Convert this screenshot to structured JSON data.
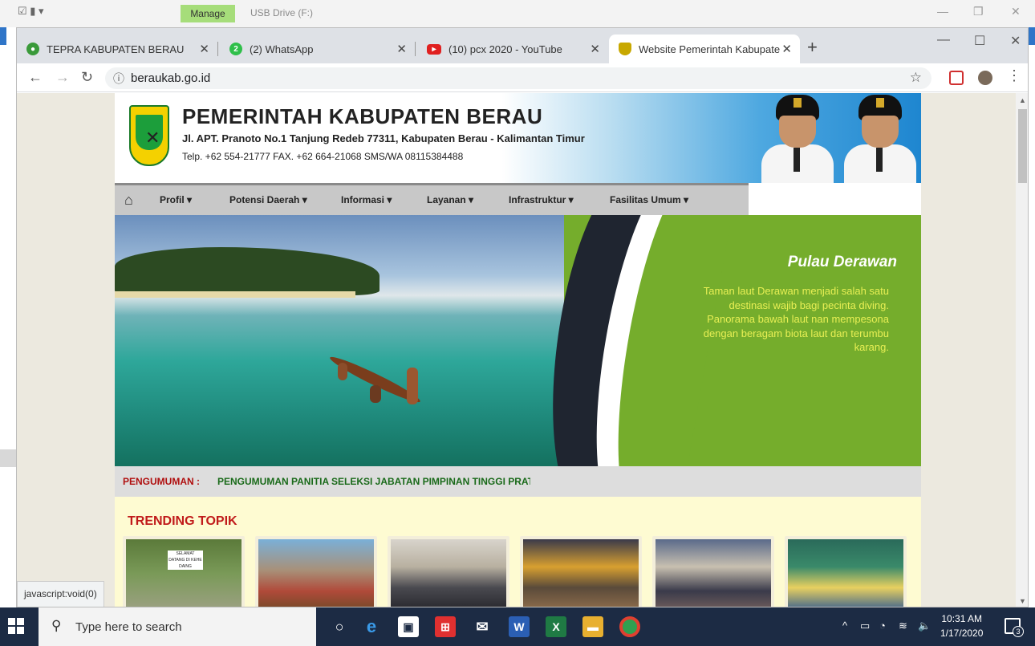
{
  "explorer": {
    "ribbon_tab": "Manage",
    "drive_title": "USB Drive (F:)"
  },
  "browser": {
    "tabs": [
      {
        "title": "TEPRA KABUPATEN BERAU",
        "icon": "tepra-favicon"
      },
      {
        "title": "(2) WhatsApp",
        "icon": "whatsapp-icon",
        "badge": "2"
      },
      {
        "title": "(10) pcx 2020 - YouTube",
        "icon": "youtube-icon"
      },
      {
        "title": "Website Pemerintah Kabupaten B",
        "icon": "berau-crest-icon",
        "active": true
      }
    ],
    "url": "beraukab.go.id",
    "status_url": "javascript:void(0)"
  },
  "site": {
    "header": {
      "title": "PEMERINTAH KABUPATEN BERAU",
      "address": "Jl. APT. Pranoto No.1 Tanjung Redeb 77311, Kabupaten Berau - Kalimantan Timur",
      "contact": "Telp. +62 554-21777  FAX. +62 664-21068  SMS/WA 08115384488"
    },
    "nav": [
      {
        "label": "Profil ▾"
      },
      {
        "label": "Potensi Daerah ▾"
      },
      {
        "label": "Informasi ▾"
      },
      {
        "label": "Layanan ▾"
      },
      {
        "label": "Infrastruktur ▾"
      },
      {
        "label": "Fasilitas Umum ▾"
      }
    ],
    "slider": {
      "title": "Pulau Derawan",
      "description": "Taman laut Derawan menjadi salah satu destinasi wajib bagi pecinta diving. Panorama bawah laut nan mempesona dengan beragam biota laut dan terumbu karang."
    },
    "announcement": {
      "label": "PENGUMUMAN :",
      "text": "PENGUMUMAN PANITIA SELEKSI JABATAN PIMPINAN TINGGI PRATAMA"
    },
    "trending": {
      "title": "TRENDING TOPIK",
      "sign_text": "SELAMAT DATANG DI KEHE DAING"
    }
  },
  "taskbar": {
    "search_placeholder": "Type here to search",
    "time": "10:31 AM",
    "date": "1/17/2020",
    "notification_count": "3"
  },
  "colors": {
    "nav_bg": "#c8c8c8",
    "slider_green": "#75ad2c",
    "slider_text": "#e8ef54",
    "announce_label": "#b01010",
    "trending_bg": "#fefbd2",
    "trending_title": "#c01a1a",
    "taskbar": "#1c2b44"
  }
}
